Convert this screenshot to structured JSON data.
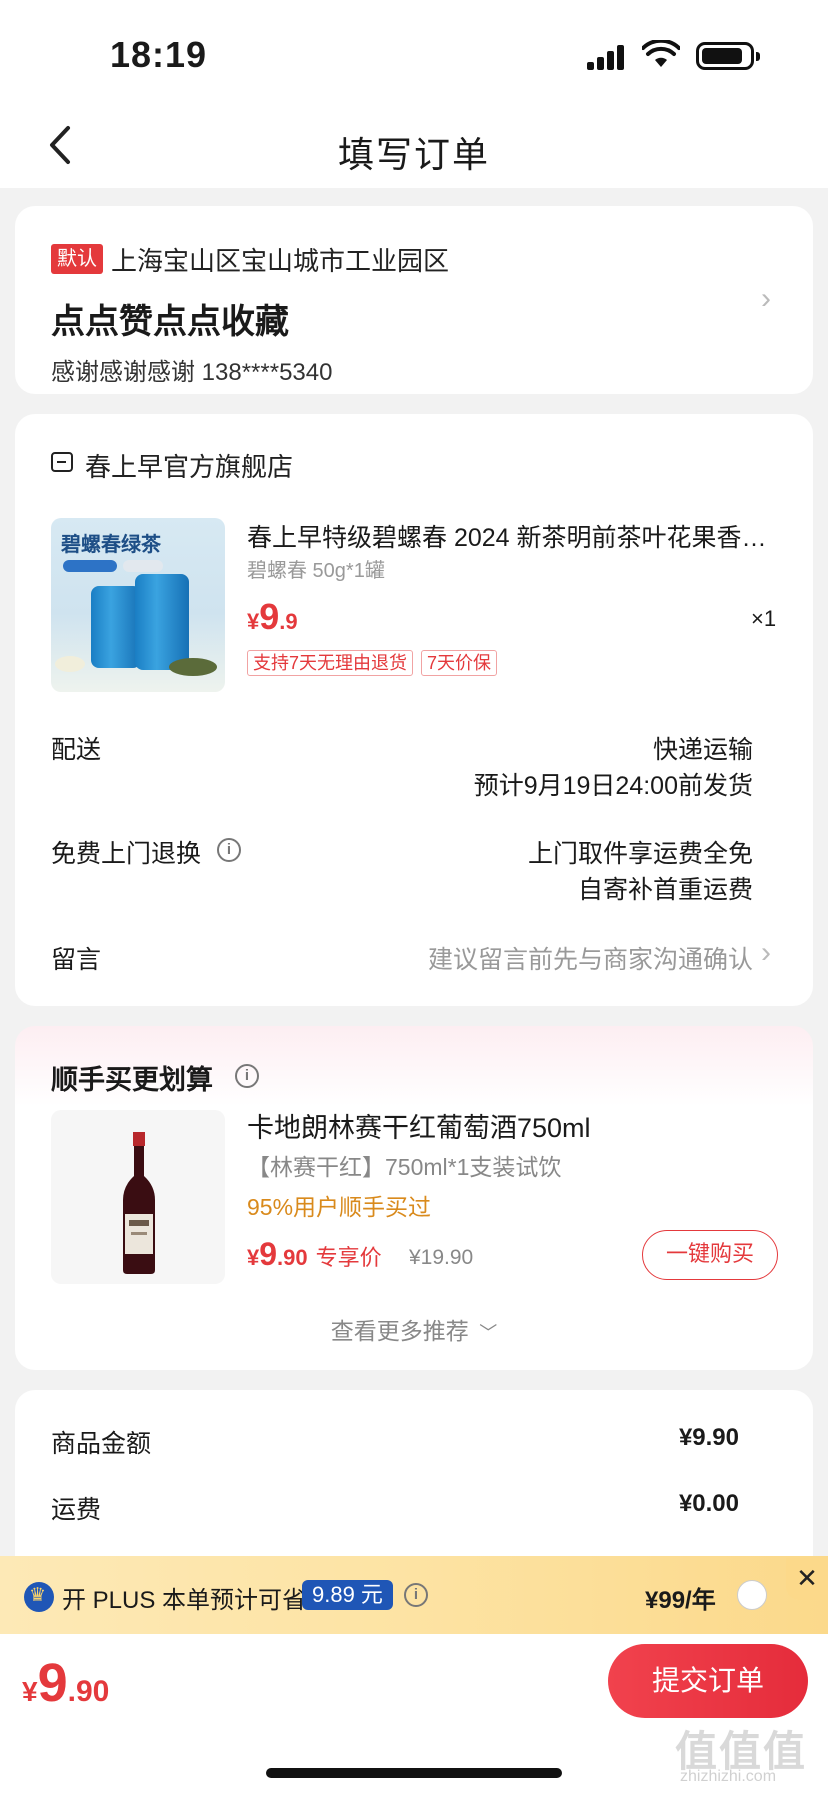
{
  "status_bar": {
    "time": "18:19"
  },
  "header": {
    "title": "填写订单"
  },
  "address": {
    "default_tag": "默认",
    "region": "上海宝山区宝山城市工业园区",
    "detail": "点点赞点点收藏",
    "contact": "感谢感谢感谢  138****5340"
  },
  "shop": {
    "name": "春上早官方旗舰店",
    "product": {
      "title": "春上早特级碧螺春 2024 新茶明前茶叶花果香…",
      "image_text": "碧螺春绿茶",
      "spec": "碧螺春 50g*1罐",
      "price_currency": "¥",
      "price_int": "9",
      "price_dec": ".9",
      "quantity": "×1",
      "tags": [
        "支持7天无理由退货",
        "7天价保"
      ]
    },
    "delivery": {
      "label": "配送",
      "method": "快递运输",
      "eta": "预计9月19日24:00前发货"
    },
    "return": {
      "label": "免费上门退换",
      "line1": "上门取件享运费全免",
      "line2": "自寄补首重运费"
    },
    "message": {
      "label": "留言",
      "placeholder": "建议留言前先与商家沟通确认"
    }
  },
  "recommend": {
    "title": "顺手买更划算",
    "item": {
      "name": "卡地朗林赛干红葡萄酒750ml",
      "spec": "【林赛干红】750ml*1支装试饮",
      "social": "95%用户顺手买过",
      "price_currency": "¥",
      "price_int": "9",
      "price_dec": ".90",
      "price_label": "专享价",
      "original_price": "¥19.90",
      "buy_label": "一键购买"
    },
    "more_label": "查看更多推荐"
  },
  "summary": {
    "goods_label": "商品金额",
    "goods_value": "¥9.90",
    "shipping_label": "运费",
    "shipping_value": "¥0.00"
  },
  "plus": {
    "text": "开 PLUS 本单预计可省",
    "saving": "9.89 元",
    "price": "¥99/年",
    "close": "✕"
  },
  "footer": {
    "total_currency": "¥",
    "total_int": "9",
    "total_dec": ".90",
    "submit_label": "提交订单",
    "watermark": "值值值",
    "watermark_sub": "zhizhizhi.com"
  },
  "colors": {
    "accent": "#e4393c",
    "plus_blue": "#1f56b6",
    "plus_bg": "#fde3a3",
    "social_orange": "#d98a1c"
  },
  "icons": [
    "back-chevron-icon",
    "signal-icon",
    "wifi-icon",
    "battery-icon",
    "shop-icon",
    "info-icon",
    "chevron-right-icon",
    "chevron-down-icon",
    "crown-icon",
    "close-icon",
    "radio-icon"
  ]
}
